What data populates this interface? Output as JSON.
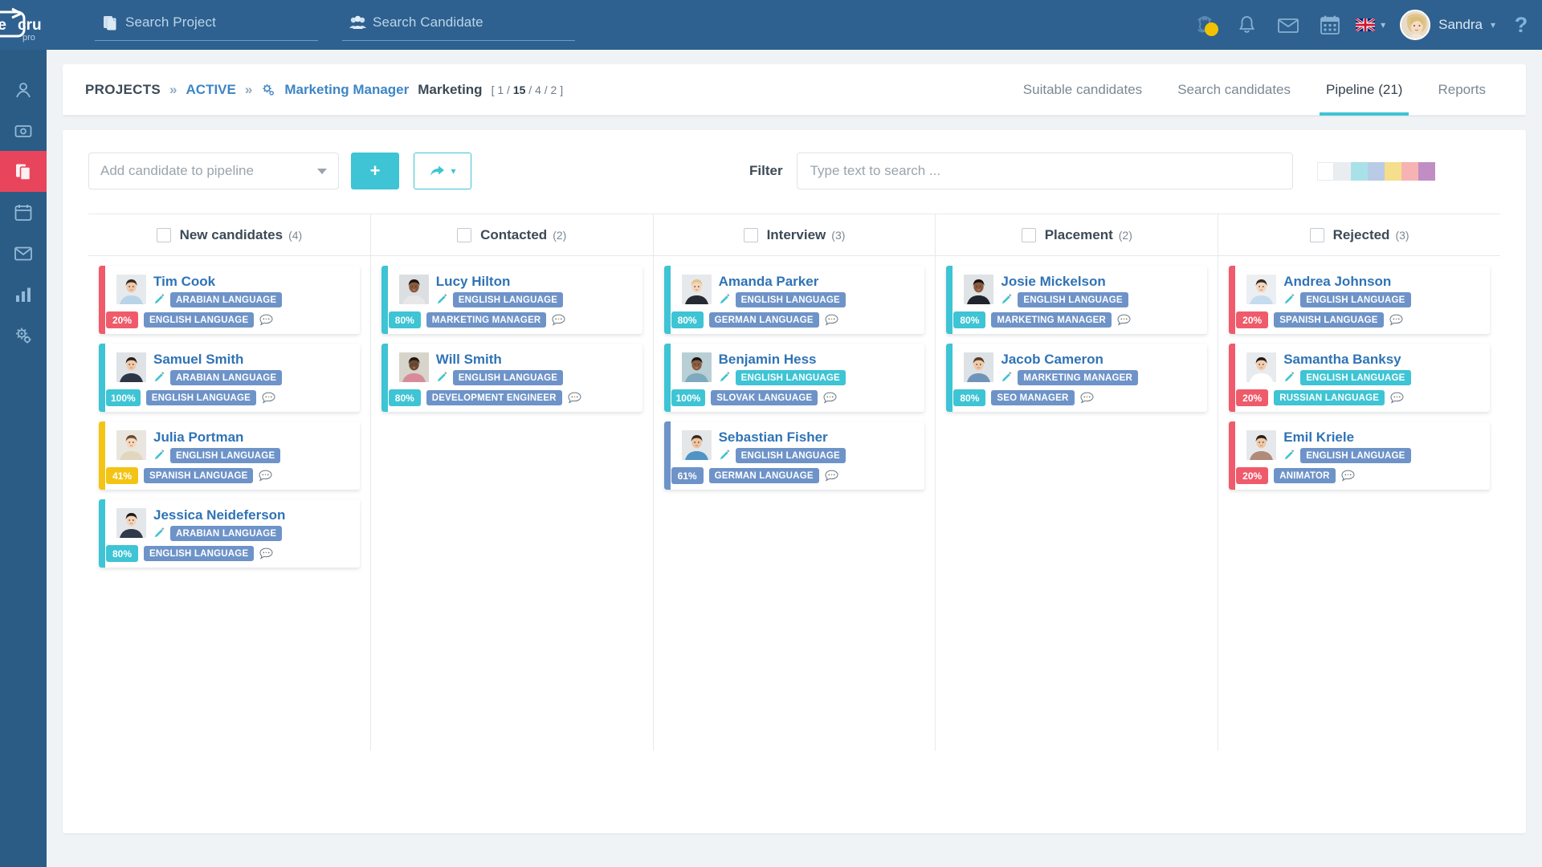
{
  "brand": {
    "name": "rejcru",
    "sub": "pro",
    "header_bg": "#2e6190",
    "rail_bg": "#2b5c86",
    "accent": "#3ec4d4"
  },
  "topbar": {
    "search_project": {
      "label": "Search Project",
      "icon": "documents-icon"
    },
    "search_candidate": {
      "label": "Search Candidate",
      "icon": "people-icon"
    },
    "icons": [
      {
        "name": "ai-assistant-icon",
        "badge": true,
        "badge_color": "#f2c200"
      },
      {
        "name": "bell-icon",
        "badge": false
      },
      {
        "name": "envelope-icon",
        "badge": false
      },
      {
        "name": "calendar-icon",
        "badge": false
      }
    ],
    "language": {
      "flag": "uk-flag-icon",
      "chevron": "chevron-down-icon"
    },
    "user": {
      "name": "Sandra",
      "chevron": "chevron-down-icon",
      "avatar": "avatar"
    },
    "help": {
      "label": "?"
    }
  },
  "rail": {
    "items": [
      {
        "name": "sidebar-item-users",
        "icon": "user-icon",
        "active": false
      },
      {
        "name": "sidebar-item-finance",
        "icon": "wallet-icon",
        "active": false
      },
      {
        "name": "sidebar-item-projects",
        "icon": "copy-icon",
        "active": true
      },
      {
        "name": "sidebar-item-calendar",
        "icon": "calendar-icon",
        "active": false
      },
      {
        "name": "sidebar-item-mail",
        "icon": "mail-icon",
        "active": false
      },
      {
        "name": "sidebar-item-reports",
        "icon": "chart-icon",
        "active": false
      },
      {
        "name": "sidebar-item-settings",
        "icon": "gears-icon",
        "active": false
      }
    ]
  },
  "breadcrumb": {
    "projects": "PROJECTS",
    "sep1": "»",
    "active": "ACTIVE",
    "sep2": "»",
    "gear": "gears-icon",
    "project": "Marketing Manager",
    "department": "Marketing",
    "counts_open": "[",
    "count1": "1",
    "slash1": "/",
    "count2": "15",
    "slash2": "/",
    "count3": "4",
    "slash3": "/",
    "count4": "2",
    "counts_close": "]"
  },
  "tabs": [
    {
      "label": "Suitable candidates",
      "active": false
    },
    {
      "label": "Search candidates",
      "active": false
    },
    {
      "label": "Pipeline (21)",
      "active": true
    },
    {
      "label": "Reports",
      "active": false
    }
  ],
  "toolbar": {
    "add_select_placeholder": "Add candidate to pipeline",
    "add_button": "+",
    "share_button_icon": "share-arrow-icon",
    "share_button_chevron": "chevron-down-icon",
    "filter_label": "Filter",
    "filter_placeholder": "Type text to search ...",
    "swatches": [
      "#ffffff",
      "#e9edf1",
      "#a8e2e8",
      "#b9cbe6",
      "#f5df8c",
      "#f7b3b3",
      "#c08ec4"
    ]
  },
  "columns": [
    {
      "title": "New candidates",
      "count": "(4)",
      "cards": [
        {
          "name": "Tim Cook",
          "stripe": "#ef5b6b",
          "pct": "20%",
          "pct_color": "#ef5b6b",
          "tag1": "ARABIAN LANGUAGE",
          "tag1_color": "blue",
          "tag2": "ENGLISH LANGUAGE",
          "tag2_color": "blue",
          "photo": "male-casual-blue"
        },
        {
          "name": "Samuel Smith",
          "stripe": "#3ec4d4",
          "pct": "100%",
          "pct_color": "#3ec4d4",
          "tag1": "ARABIAN LANGUAGE",
          "tag1_color": "blue",
          "tag2": "ENGLISH LANGUAGE",
          "tag2_color": "blue",
          "photo": "male-suit-dark"
        },
        {
          "name": "Julia Portman",
          "stripe": "#f3c414",
          "pct": "41%",
          "pct_color": "#f3c414",
          "tag1": "ENGLISH LANGUAGE",
          "tag1_color": "blue",
          "tag2": "SPANISH LANGUAGE",
          "tag2_color": "blue",
          "photo": "female-beige"
        },
        {
          "name": "Jessica Neideferson",
          "stripe": "#3ec4d4",
          "pct": "80%",
          "pct_color": "#3ec4d4",
          "tag1": "ARABIAN LANGUAGE",
          "tag1_color": "blue",
          "tag2": "ENGLISH LANGUAGE",
          "tag2_color": "blue",
          "photo": "female-dark-suit"
        }
      ]
    },
    {
      "title": "Contacted",
      "count": "(2)",
      "cards": [
        {
          "name": "Lucy Hilton",
          "stripe": "#3ec4d4",
          "pct": "80%",
          "pct_color": "#3ec4d4",
          "tag1": "ENGLISH LANGUAGE",
          "tag1_color": "blue",
          "tag2": "MARKETING MANAGER",
          "tag2_color": "blue",
          "photo": "female-curly-dark"
        },
        {
          "name": "Will Smith",
          "stripe": "#3ec4d4",
          "pct": "80%",
          "pct_color": "#3ec4d4",
          "tag1": "ENGLISH LANGUAGE",
          "tag1_color": "blue",
          "tag2": "DEVELOPMENT ENGINEER",
          "tag2_color": "blue",
          "photo": "male-pink-shirt"
        }
      ]
    },
    {
      "title": "Interview",
      "count": "(3)",
      "cards": [
        {
          "name": "Amanda Parker",
          "stripe": "#3ec4d4",
          "pct": "80%",
          "pct_color": "#3ec4d4",
          "tag1": "ENGLISH LANGUAGE",
          "tag1_color": "blue",
          "tag2": "GERMAN LANGUAGE",
          "tag2_color": "blue",
          "photo": "female-blonde-black"
        },
        {
          "name": "Benjamin Hess",
          "stripe": "#3ec4d4",
          "pct": "100%",
          "pct_color": "#3ec4d4",
          "tag1": "ENGLISH LANGUAGE",
          "tag1_color": "teal",
          "tag2": "SLOVAK LANGUAGE",
          "tag2_color": "blue",
          "photo": "male-smiling-teal"
        },
        {
          "name": "Sebastian Fisher",
          "stripe": "#6e93c8",
          "pct": "61%",
          "pct_color": "#6e93c8",
          "tag1": "ENGLISH LANGUAGE",
          "tag1_color": "blue",
          "tag2": "GERMAN LANGUAGE",
          "tag2_color": "blue",
          "photo": "male-beard-blue"
        }
      ]
    },
    {
      "title": "Placement",
      "count": "(2)",
      "cards": [
        {
          "name": "Josie Mickelson",
          "stripe": "#3ec4d4",
          "pct": "80%",
          "pct_color": "#3ec4d4",
          "tag1": "ENGLISH LANGUAGE",
          "tag1_color": "blue",
          "tag2": "MARKETING MANAGER",
          "tag2_color": "blue",
          "photo": "female-afro-black"
        },
        {
          "name": "Jacob Cameron",
          "stripe": "#3ec4d4",
          "pct": "80%",
          "pct_color": "#3ec4d4",
          "tag1": "MARKETING MANAGER",
          "tag1_color": "blue",
          "tag2": "SEO MANAGER",
          "tag2_color": "blue",
          "photo": "male-denim-beard"
        }
      ]
    },
    {
      "title": "Rejected",
      "count": "(3)",
      "cards": [
        {
          "name": "Andrea Johnson",
          "stripe": "#ef5b6b",
          "pct": "20%",
          "pct_color": "#ef5b6b",
          "tag1": "ENGLISH LANGUAGE",
          "tag1_color": "blue",
          "tag2": "SPANISH LANGUAGE",
          "tag2_color": "blue",
          "photo": "female-lightblue-shirt"
        },
        {
          "name": "Samantha Banksy",
          "stripe": "#ef5b6b",
          "pct": "20%",
          "pct_color": "#ef5b6b",
          "tag1": "ENGLISH LANGUAGE",
          "tag1_color": "teal",
          "tag2": "RUSSIAN LANGUAGE",
          "tag2_color": "teal",
          "photo": "female-long-dark-hair"
        },
        {
          "name": "Emil Kriele",
          "stripe": "#ef5b6b",
          "pct": "20%",
          "pct_color": "#ef5b6b",
          "tag1": "ENGLISH LANGUAGE",
          "tag1_color": "blue",
          "tag2": "ANIMATOR",
          "tag2_color": "blue",
          "photo": "male-plaid-shirt"
        }
      ]
    }
  ]
}
